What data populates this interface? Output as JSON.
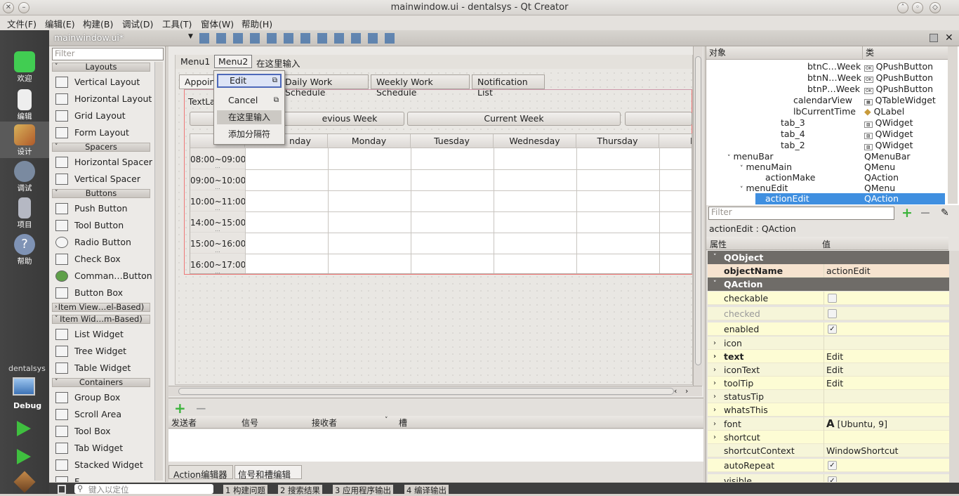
{
  "window": {
    "title": "mainwindow.ui - dentalsys - Qt Creator"
  },
  "menubar": [
    "文件(F)",
    "编辑(E)",
    "构建(B)",
    "调试(D)",
    "工具(T)",
    "窗体(W)",
    "帮助(H)"
  ],
  "modes": [
    "欢迎",
    "编辑",
    "设计",
    "调试",
    "项目",
    "帮助"
  ],
  "kit": {
    "project": "dentalsys",
    "config": "Debug"
  },
  "file": {
    "name": "mainwindow.ui*"
  },
  "widgetbox": {
    "filter_placeholder": "Filter",
    "cats": {
      "layouts": "Layouts",
      "spacers": "Spacers",
      "buttons": "Buttons",
      "itemview": "Item View…el-Based)",
      "itemwidgets": "Item Wid…m-Based)",
      "containers": "Containers"
    },
    "items": {
      "vl": "Vertical Layout",
      "hl": "Horizontal Layout",
      "gl": "Grid Layout",
      "fl": "Form Layout",
      "hs": "Horizontal Spacer",
      "vs": "Vertical Spacer",
      "pb": "Push Button",
      "tb": "Tool Button",
      "rb": "Radio Button",
      "cb": "Check Box",
      "cmd": "Comman…Button",
      "bb": "Button Box",
      "lw": "List Widget",
      "tw": "Tree Widget",
      "tabw": "Table Widget",
      "gb": "Group Box",
      "sa": "Scroll Area",
      "toolbox": "Tool Box",
      "tabwidget": "Tab Widget",
      "sw": "Stacked Widget",
      "f": "F"
    }
  },
  "form": {
    "menus": [
      "Menu1",
      "Menu2",
      "在这里输入"
    ],
    "tabs": {
      "appoint": "Appoin",
      "daily": "Daily Work Schedule",
      "weekly": "Weekly Work Schedule",
      "notif": "Notification List"
    },
    "textlabel": "TextLa",
    "nav": {
      "prev": "evious Week",
      "current": "Current Week"
    },
    "table": {
      "columns": {
        "c0": "nday",
        "c1": "Monday",
        "c2": "Tuesday",
        "c3": "Wednesday",
        "c4": "Thursday",
        "c5": "F"
      },
      "rows": {
        "r0": "08:00~09:00",
        "r1": "09:00~10:00",
        "r2": "10:00~11:00",
        "r3": "14:00~15:00",
        "r4": "15:00~16:00",
        "r5": "16:00~17:00"
      },
      "dots": "..."
    },
    "popup": {
      "edit": "Edit",
      "cancel": "Cancel",
      "type": "在这里输入",
      "sep": "添加分隔符"
    }
  },
  "signals": {
    "col_sender": "发送者",
    "col_signal": "信号",
    "col_receiver": "接收者",
    "col_slot": "槽",
    "tab_action": "Action编辑器",
    "tab_signals": "信号和槽编辑器"
  },
  "objtree": {
    "h_obj": "对象",
    "h_class": "类",
    "r0o": "btnC…Week",
    "r0c": "QPushButton",
    "r1o": "btnN…Week",
    "r1c": "QPushButton",
    "r2o": "btnP…Week",
    "r2c": "QPushButton",
    "r3o": "calendarView",
    "r3c": "QTableWidget",
    "r4o": "lbCurrentTime",
    "r4c": "QLabel",
    "r5o": "tab_3",
    "r5c": "QWidget",
    "r6o": "tab_4",
    "r6c": "QWidget",
    "r7o": "tab_2",
    "r7c": "QWidget",
    "r8o": "menuBar",
    "r8c": "QMenuBar",
    "r9o": "menuMain",
    "r9c": "QMenu",
    "r10o": "actionMake",
    "r10c": "QAction",
    "r11o": "menuEdit",
    "r11c": "QMenu",
    "r12o": "actionEdit",
    "r12c": "QAction"
  },
  "props": {
    "filter_placeholder": "Filter",
    "title": "actionEdit : QAction",
    "h_prop": "属性",
    "h_val": "值",
    "g1": "QObject",
    "g2": "QAction",
    "objectName": "objectName",
    "objectName_v": "actionEdit",
    "checkable": "checkable",
    "checked": "checked",
    "enabled": "enabled",
    "icon": "icon",
    "text": "text",
    "text_v": "Edit",
    "iconText": "iconText",
    "iconText_v": "Edit",
    "toolTip": "toolTip",
    "toolTip_v": "Edit",
    "statusTip": "statusTip",
    "whatsThis": "whatsThis",
    "font": "font",
    "font_v": "[Ubuntu, 9]",
    "shortcut": "shortcut",
    "shortcutContext": "shortcutContext",
    "shortcutContext_v": "WindowShortcut",
    "autoRepeat": "autoRepeat",
    "visible": "visible"
  },
  "status": {
    "locate_placeholder": "键入以定位",
    "t1": "1 构建问题",
    "t2": "2 搜索结果",
    "t3": "3 应用程序输出",
    "t4": "4 编译输出"
  }
}
